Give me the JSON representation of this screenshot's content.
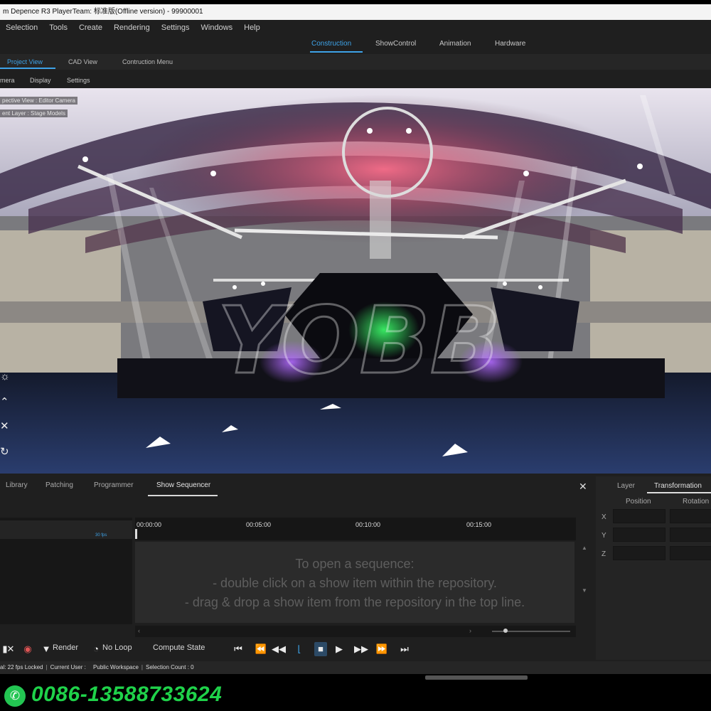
{
  "window": {
    "title": "m Depence R3  PlayerTeam: 标准版(Offline version) - 99900001"
  },
  "menu": [
    "Selection",
    "Tools",
    "Create",
    "Rendering",
    "Settings",
    "Windows",
    "Help"
  ],
  "modes": {
    "items": [
      "Construction",
      "ShowControl",
      "Animation",
      "Hardware"
    ],
    "active": "Construction"
  },
  "subtabs": {
    "items": [
      "Project View",
      "CAD View",
      "Contruction Menu"
    ],
    "active": "Project View"
  },
  "view_menu": [
    "mera",
    "Display",
    "Settings"
  ],
  "viewport": {
    "camera_label": "pective View : Editor Camera",
    "layer_label": "ent Layer : Stage Models",
    "tools": [
      "sun-icon",
      "cone-icon",
      "cross-arrows-icon",
      "rotate-icon"
    ]
  },
  "bottom_tabs": {
    "items": [
      "Library",
      "Patching",
      "Programmer",
      "Show Sequencer"
    ],
    "active": "Show Sequencer"
  },
  "close_symbol": "✕",
  "timeline": {
    "ticks": [
      "00:00:00",
      "00:05:00",
      "00:10:00",
      "00:15:00"
    ],
    "fps_badge": "30 fps"
  },
  "sequencer_message": {
    "line1": "To open a sequence:",
    "line2": "- double click on a show item within the repository.",
    "line3": "- drag & drop a show item from the repository in the top line."
  },
  "transport": {
    "render_label": "Render",
    "loop_label": "No Loop",
    "compute_label": "Compute State",
    "icons": [
      "skip-to-start-icon",
      "step-back-icon",
      "rewind-icon",
      "loop-marker-icon",
      "stop-icon",
      "play-icon",
      "fast-forward-icon",
      "step-forward-icon",
      "skip-to-end-icon"
    ]
  },
  "right_panel": {
    "tabs": [
      "Layer",
      "Transformation"
    ],
    "active": "Transformation",
    "headers": [
      "Position",
      "Rotation"
    ],
    "axes": [
      "X",
      "Y",
      "Z"
    ]
  },
  "status": {
    "fps": "al: 22 fps Locked",
    "user": "Current User :",
    "workspace": "Public Workspace",
    "selection": "Selection Count : 0"
  },
  "overlay": {
    "phone": "0086-13588733624",
    "brand_watermark": "YOBB"
  },
  "colors": {
    "accent": "#3ea3e8",
    "whatsapp": "#23c552"
  }
}
